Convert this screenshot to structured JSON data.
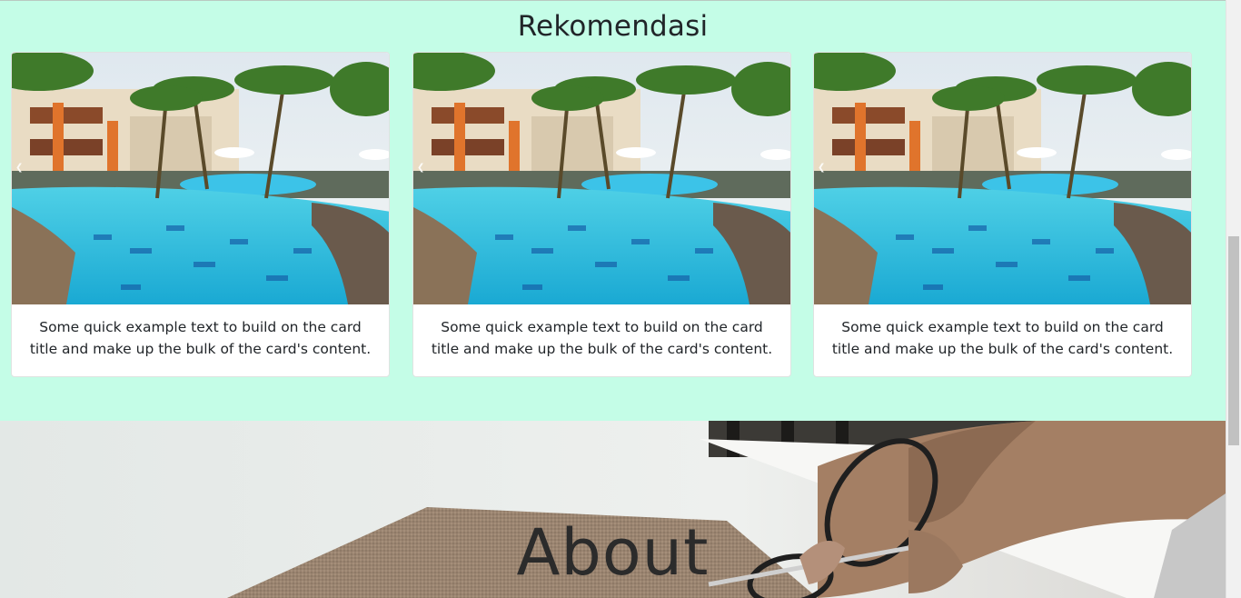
{
  "recommendations": {
    "title": "Rekomendasi",
    "cards": [
      {
        "image": "hotel-pool-photo",
        "text": "Some quick example text to build on the card title and make up the bulk of the card's content."
      },
      {
        "image": "hotel-pool-photo",
        "text": "Some quick example text to build on the card title and make up the bulk of the card's content."
      },
      {
        "image": "hotel-pool-photo",
        "text": "Some quick example text to build on the card title and make up the bulk of the card's content."
      }
    ]
  },
  "about": {
    "title": "About",
    "background_image": "hands-cutting-fabric-photo"
  },
  "icons": {
    "carousel_prev": "chevron-left-icon"
  },
  "colors": {
    "section_bg": "#c4fde7",
    "card_bg": "#ffffff",
    "text": "#212529"
  }
}
